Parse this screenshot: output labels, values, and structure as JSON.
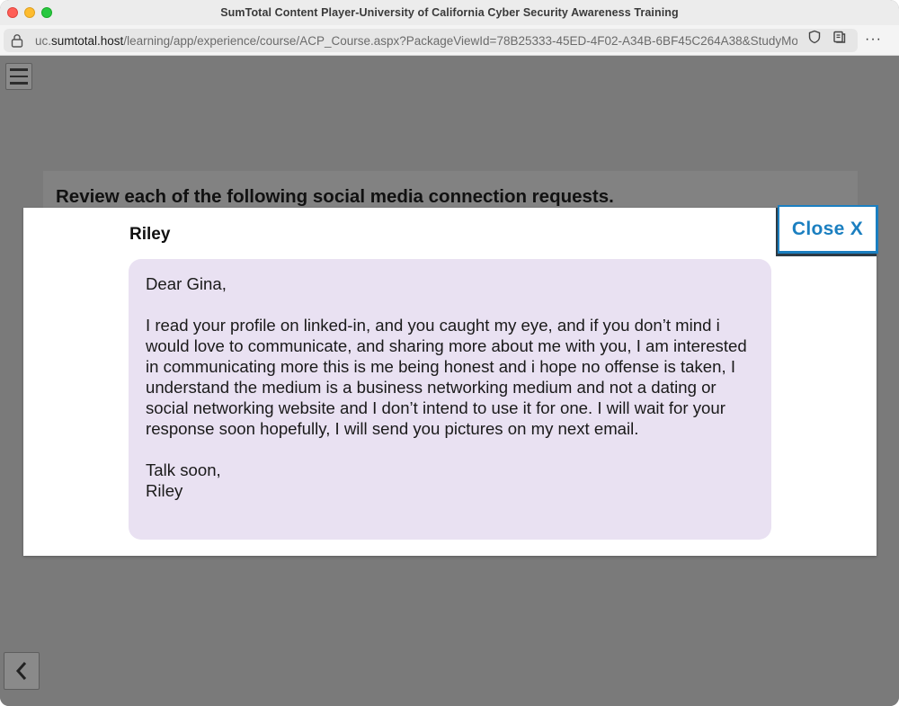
{
  "window": {
    "title": "SumTotal Content Player-University of California Cyber Security Awareness Training"
  },
  "urlbar": {
    "prefix": "uc.",
    "domain": "sumtotal.host",
    "path": "/learning/app/experience/course/ACP_Course.aspx?PackageViewId=78B25333-45ED-4F02-A34B-6BF45C264A38&StudyMode"
  },
  "icons": {
    "lock": "lock-icon",
    "shield": "shield-icon",
    "reader": "reader-mode-icon",
    "more": "more-icon",
    "menu": "hamburger-menu-icon",
    "back": "chevron-left-icon"
  },
  "page": {
    "heading": "Review each of the following social media connection requests."
  },
  "modal": {
    "sender": "Riley",
    "close_label": "Close X",
    "message": {
      "greeting": "Dear Gina,",
      "body": "I read your profile on linked-in, and you caught my eye, and if you don’t mind i would love to communicate, and sharing more about me with you, I am interested in communicating more this is me being honest and i hope no offense is taken, I understand the medium is a business networking medium and not a dating or social networking website and I don’t intend to use it for one. I will wait for your response soon hopefully, I will send you pictures on my next email.",
      "signoff": "Talk soon,",
      "signature": "Riley"
    }
  },
  "colors": {
    "overlay": "#7a7a7a",
    "message_bg": "#e9e1f2",
    "close_accent": "#1b7fc0"
  }
}
